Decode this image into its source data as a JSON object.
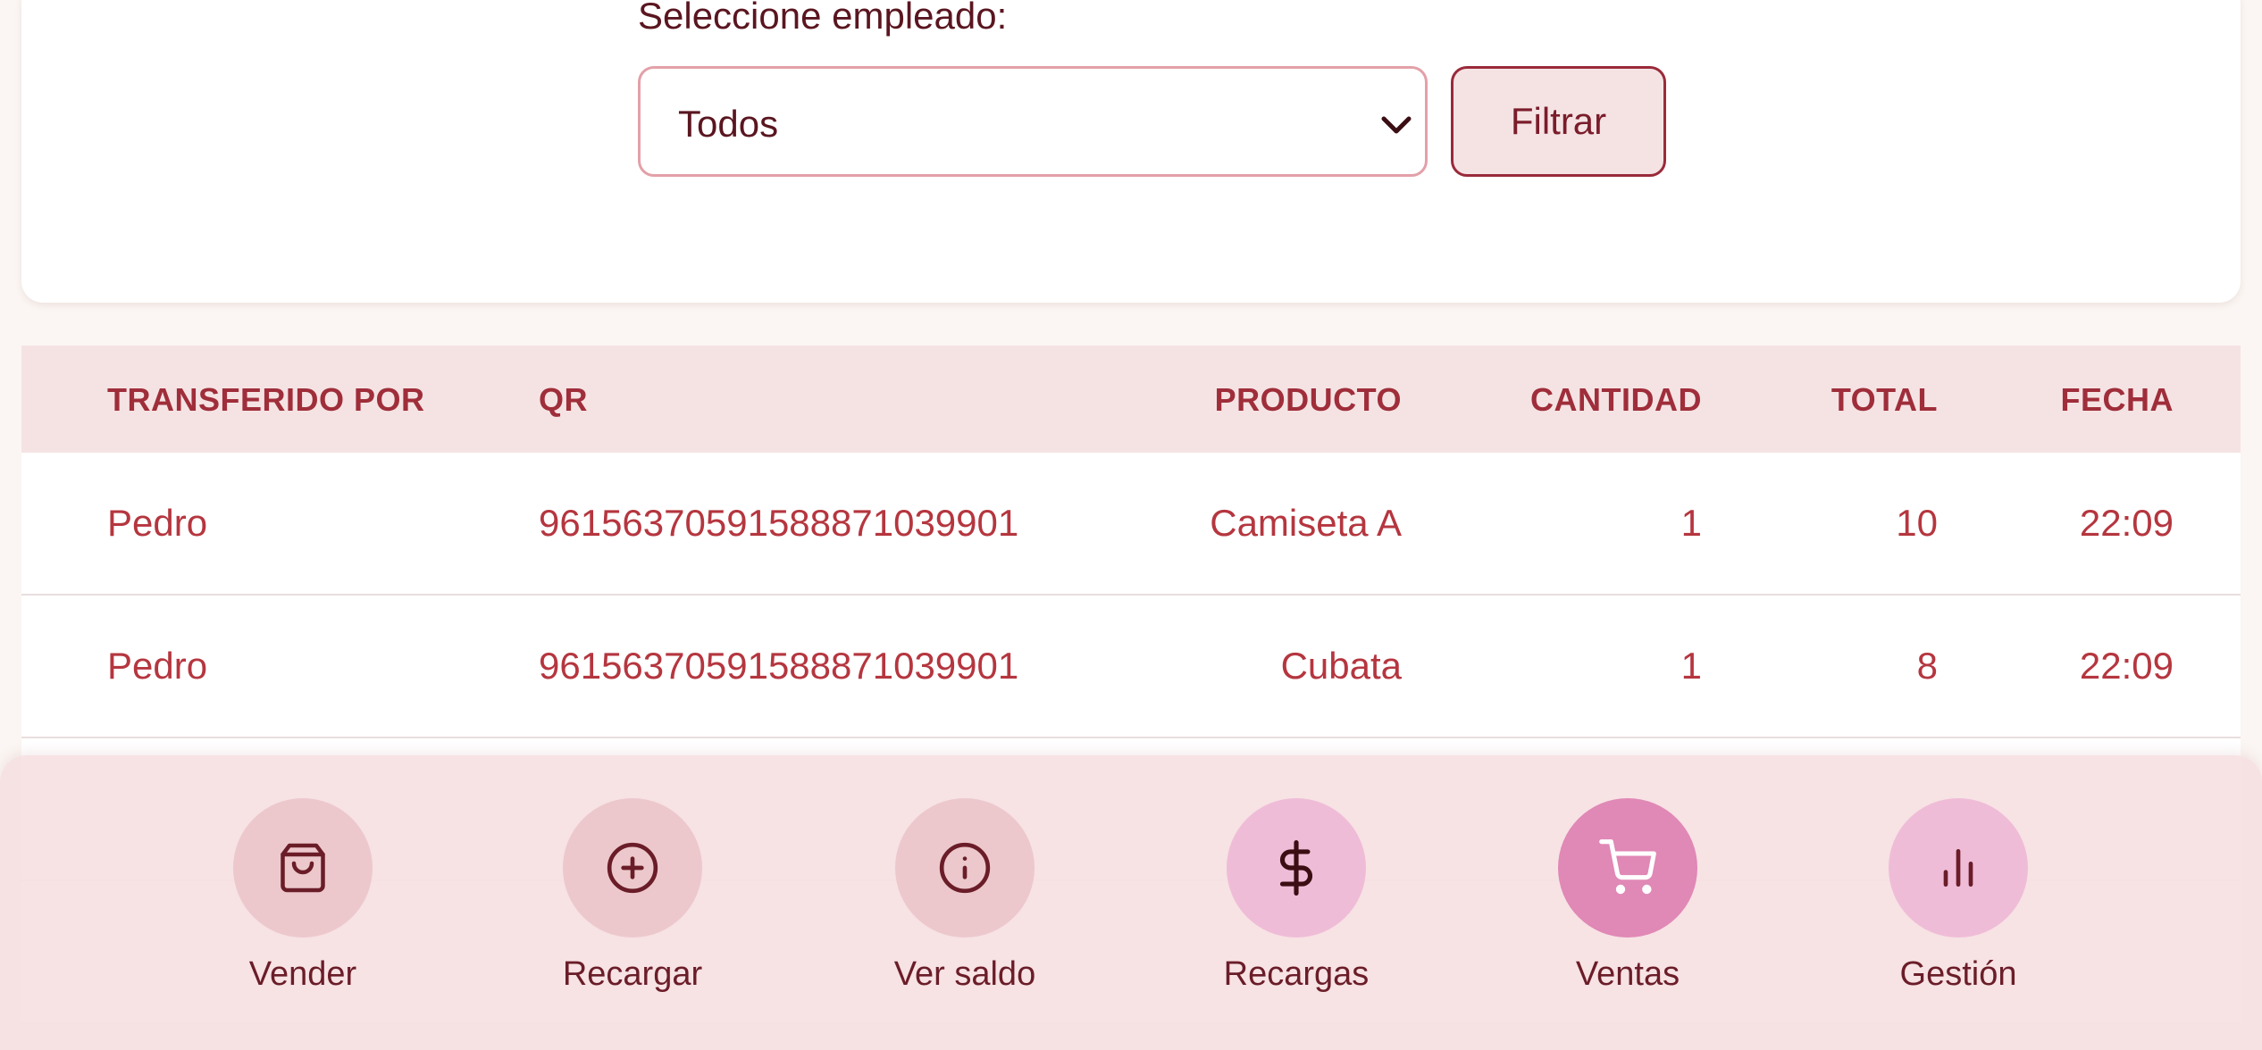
{
  "filter": {
    "label": "Seleccione empleado:",
    "selected": "Todos",
    "button_label": "Filtrar"
  },
  "table": {
    "headers": [
      "TRANSFERIDO POR",
      "QR",
      "PRODUCTO",
      "CANTIDAD",
      "TOTAL",
      "FECHA"
    ],
    "rows": [
      [
        "Pedro",
        "96156370591588871039901",
        "Camiseta A",
        "1",
        "10",
        "22:09"
      ],
      [
        "Pedro",
        "96156370591588871039901",
        "Cubata",
        "1",
        "8",
        "22:09"
      ]
    ]
  },
  "nav": {
    "items": [
      {
        "label": "Vender",
        "icon": "shopping-bag-icon"
      },
      {
        "label": "Recargar",
        "icon": "plus-circle-icon"
      },
      {
        "label": "Ver saldo",
        "icon": "info-circle-icon"
      },
      {
        "label": "Recargas",
        "icon": "dollar-icon"
      },
      {
        "label": "Ventas",
        "icon": "cart-icon"
      },
      {
        "label": "Gestión",
        "icon": "bar-chart-icon"
      }
    ],
    "active": "Ventas"
  },
  "colors": {
    "accent": "#9f2e3a",
    "active_nav": "#e088b6",
    "header_bg": "#f5e3e4"
  }
}
